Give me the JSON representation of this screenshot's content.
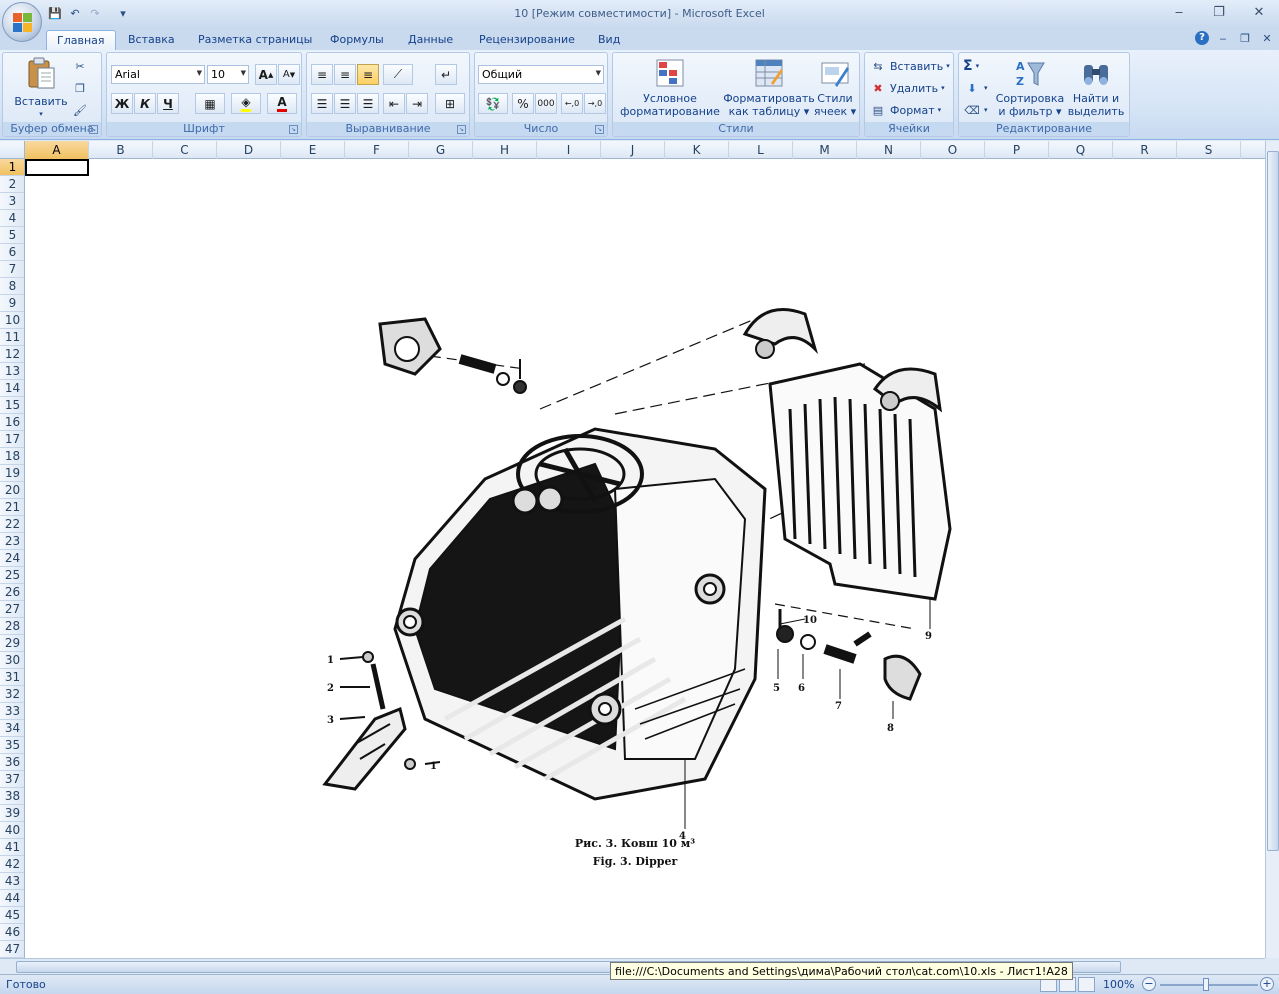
{
  "window": {
    "title": "10  [Режим совместимости] - Microsoft Excel"
  },
  "qat": {
    "save": "💾",
    "undo": "↶",
    "redo": "↷",
    "customize": "▾"
  },
  "window_controls": {
    "minimize": "‒",
    "restore": "❐",
    "close": "✕"
  },
  "tabs": [
    {
      "label": "Главная",
      "active": true
    },
    {
      "label": "Вставка"
    },
    {
      "label": "Разметка страницы"
    },
    {
      "label": "Формулы"
    },
    {
      "label": "Данные"
    },
    {
      "label": "Рецензирование"
    },
    {
      "label": "Вид"
    }
  ],
  "ribbon": {
    "clipboard": {
      "paste": "Вставить",
      "label": "Буфер обмена"
    },
    "font": {
      "name": "Arial",
      "size": "10",
      "label": "Шрифт",
      "grow": "A",
      "shrink": "A",
      "bold": "Ж",
      "italic": "К",
      "underline": "Ч",
      "font_color_letter": "A"
    },
    "alignment": {
      "label": "Выравнивание"
    },
    "number": {
      "format": "Общий",
      "label": "Число",
      "percent": "%",
      "thousands": "000"
    },
    "styles": {
      "label": "Стили",
      "conditional": "Условное\nформатирование",
      "conditional_1": "Условное",
      "conditional_2": "форматирование",
      "table_1": "Форматировать",
      "table_2": "как таблицу",
      "cell_1": "Стили",
      "cell_2": "ячеек"
    },
    "cells": {
      "label": "Ячейки",
      "insert": "Вставить",
      "delete": "Удалить",
      "format": "Формат"
    },
    "editing": {
      "label": "Редактирование",
      "sort_1": "Сортировка",
      "sort_2": "и фильтр",
      "find_1": "Найти и",
      "find_2": "выделить",
      "sum": "Σ"
    }
  },
  "columns": [
    "A",
    "B",
    "C",
    "D",
    "E",
    "F",
    "G",
    "H",
    "I",
    "J",
    "K",
    "L",
    "M",
    "N",
    "O",
    "P",
    "Q",
    "R",
    "S"
  ],
  "rows": [
    "1",
    "2",
    "3",
    "4",
    "5",
    "6",
    "7",
    "8",
    "9",
    "10",
    "11",
    "12",
    "13",
    "14",
    "15",
    "16",
    "17",
    "18",
    "19",
    "20",
    "21",
    "22",
    "23",
    "24",
    "25",
    "26",
    "27",
    "28",
    "29",
    "30",
    "31",
    "32",
    "33",
    "34",
    "35",
    "36",
    "37",
    "38",
    "39",
    "40",
    "41",
    "42",
    "43",
    "44",
    "45",
    "46",
    "47"
  ],
  "figure": {
    "caption_ru": "Рис. 3. Ковш 10 м³",
    "caption_en": "Fig. 3. Dipper",
    "callouts": [
      "1",
      "2",
      "3",
      "1",
      "4",
      "5",
      "6",
      "7",
      "8",
      "9",
      "10"
    ]
  },
  "status": {
    "ready": "Готово",
    "tooltip": "file:///C:\\Documents and Settings\\дима\\Рабочий стол\\cat.com\\10.xls - Лист1!A28",
    "zoom": "100%",
    "zoom_minus": "−",
    "zoom_plus": "+"
  }
}
